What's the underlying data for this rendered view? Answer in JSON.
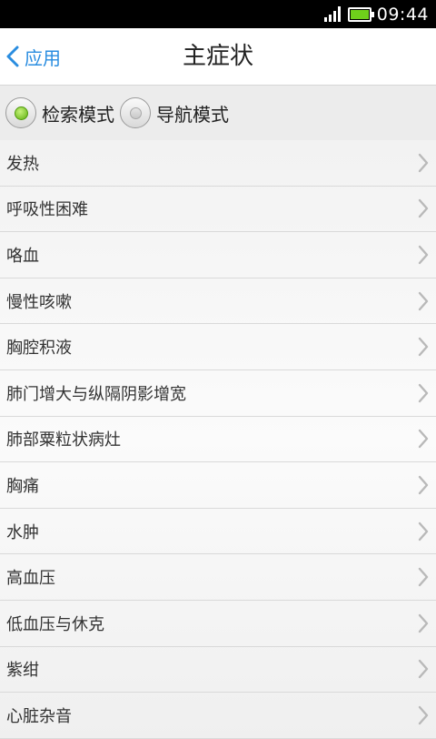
{
  "status_bar": {
    "time": "09:44",
    "icons": [
      "signal-icon",
      "battery-icon"
    ],
    "battery_color": "#6fd01b"
  },
  "header": {
    "back_label": "应用",
    "title": "主症状",
    "accent_color": "#2a8de0"
  },
  "modes": {
    "options": [
      {
        "label": "检索模式",
        "selected": true
      },
      {
        "label": "导航模式",
        "selected": false
      }
    ]
  },
  "symptoms": {
    "items": [
      {
        "label": "发热"
      },
      {
        "label": "呼吸性困难"
      },
      {
        "label": "咯血"
      },
      {
        "label": "慢性咳嗽"
      },
      {
        "label": "胸腔积液"
      },
      {
        "label": "肺门增大与纵隔阴影增宽"
      },
      {
        "label": "肺部粟粒状病灶"
      },
      {
        "label": "胸痛"
      },
      {
        "label": "水肿"
      },
      {
        "label": "高血压"
      },
      {
        "label": "低血压与休克"
      },
      {
        "label": "紫绀"
      },
      {
        "label": "心脏杂音"
      }
    ],
    "row_icon": "chevron-right-icon"
  }
}
